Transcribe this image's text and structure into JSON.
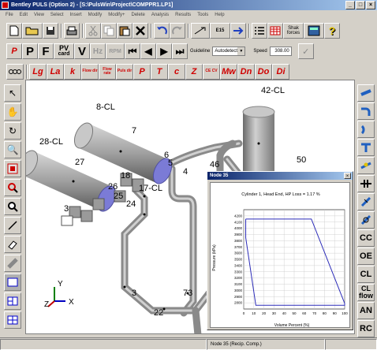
{
  "window": {
    "title": "Bentley PULS (Option 2) - [S:\\PulsWin\\Project\\COMPPR1.LP1]"
  },
  "window_buttons": [
    "_",
    "□",
    "×"
  ],
  "menu": [
    "File",
    "Edit",
    "View",
    "Select",
    "Insert",
    "Modify",
    "Modify+",
    "Delete",
    "Analysis",
    "Results",
    "Tools",
    "Help"
  ],
  "toolbar1": {
    "ship_forces": "Shak forces",
    "ship_forces_lines": [
      "Shak",
      "forces"
    ],
    "e15_label": "E15"
  },
  "toolbar2": {
    "p": "P",
    "f": "F",
    "pv": "PV",
    "card": "card",
    "v": "V",
    "hz": "Hz",
    "rpm": "RPM",
    "guideline_label": "Guideline",
    "guideline_value": "Autodetect",
    "speed_label": "Speed",
    "speed_value": "308.00"
  },
  "toolbar3": {
    "buttons": [
      "Lg",
      "La",
      "k",
      "Flow dir",
      "Flow rate",
      "Puls dir",
      "P",
      "T",
      "c",
      "Z",
      "CE CV",
      "Mw",
      "Dn",
      "Do",
      "Di"
    ]
  },
  "rightbar": {
    "cc": "CC",
    "oe": "OE",
    "cl": "CL",
    "clflow": "CL flow",
    "clflow_lines": [
      "CL",
      "flow"
    ],
    "an": "AN",
    "rc": "RC"
  },
  "model": {
    "labels": [
      "8-CL",
      "7",
      "28-CL",
      "27",
      "42-CL",
      "50",
      "46",
      "6",
      "5",
      "4",
      "18",
      "26",
      "25",
      "24",
      "17-CL",
      "3",
      "22",
      "73",
      "3"
    ],
    "axes": {
      "y": "Y",
      "z": "Z",
      "x": "X"
    }
  },
  "colors": {
    "cylinder_blue": "#7b7bd6",
    "pipe_gray": "#a8a8a8",
    "titlebar": "#0a246a",
    "chart_line": "#2b2bb8"
  },
  "popup": {
    "title": "Node 35",
    "close": "×",
    "subtitle": "Cylinder 1, Head End, HP Loss = 1.17 %"
  },
  "chart_data": {
    "type": "line",
    "title": "Cylinder 1, Head End, HP Loss = 1.17 %",
    "xlabel": "Volume Percent (%)",
    "ylabel": "Pressure (kPa)",
    "xlim": [
      0,
      100
    ],
    "ylim": [
      2700,
      4300
    ],
    "xticks": [
      0,
      10,
      20,
      30,
      40,
      50,
      60,
      70,
      80,
      90,
      100
    ],
    "yticks": [
      2800,
      2900,
      3000,
      3100,
      3200,
      3300,
      3400,
      3500,
      3600,
      3700,
      3800,
      3900,
      4000,
      4100,
      4200
    ],
    "grid": true,
    "series": [
      {
        "x": [
          2,
          67,
          100,
          100,
          12,
          2,
          2
        ],
        "y": [
          4150,
          4150,
          2790,
          2760,
          2760,
          3850,
          4150
        ]
      }
    ]
  },
  "status": {
    "cell1": "",
    "cell2": "Node 35 (Recip. Comp.)",
    "cell3": ""
  }
}
